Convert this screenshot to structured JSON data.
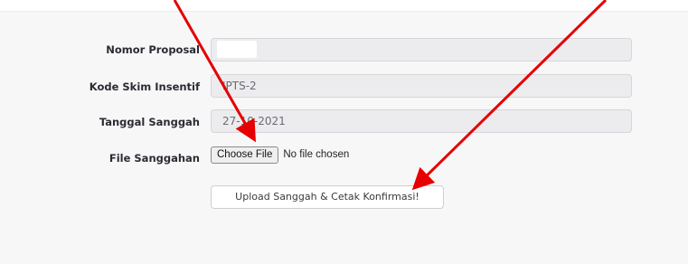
{
  "form": {
    "nomor_proposal": {
      "label": "Nomor Proposal",
      "value": ""
    },
    "kode_skim": {
      "label": "Kode Skim Insentif",
      "value": "IPTS-2"
    },
    "tanggal_sanggah": {
      "label": "Tanggal Sanggah",
      "value": "27-10-2021"
    },
    "file_sanggahan": {
      "label": "File Sanggahan",
      "button_label": "Choose File",
      "status": "No file chosen"
    },
    "submit_label": "Upload Sanggah & Cetak Konfirmasi!"
  },
  "annotations": {
    "arrow_color": "#e60000"
  }
}
